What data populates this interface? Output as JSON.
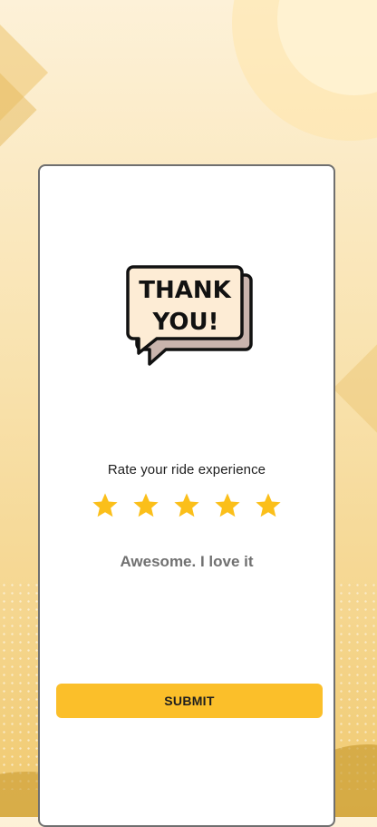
{
  "card": {
    "graphic": {
      "icon": "thank-you-speech-bubble-icon",
      "line1": "THANK",
      "line2": "YOU!"
    },
    "rate_label": "Rate your ride experience",
    "rating": {
      "value": 5,
      "max": 5,
      "icon": "star-icon",
      "color": "#fbbf1a",
      "text": "Awesome. I love it"
    },
    "submit_label": "SUBMIT"
  },
  "colors": {
    "accent": "#fbbf2a",
    "bubble_fill": "#fdecd5",
    "bubble_shadow": "#c9b4ad"
  }
}
